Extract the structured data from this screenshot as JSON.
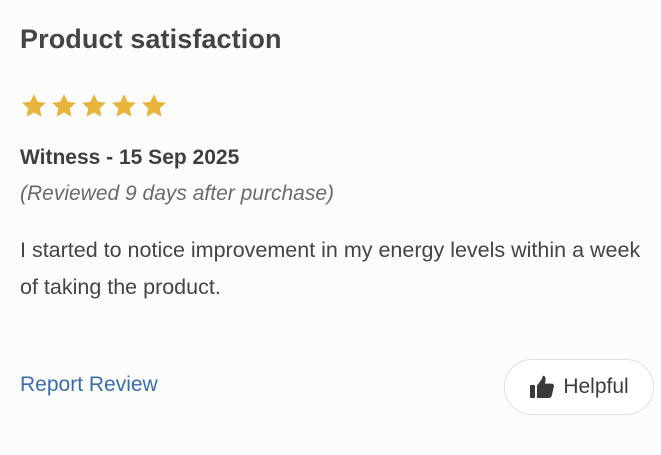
{
  "review": {
    "title": "Product satisfaction",
    "rating": 5,
    "rating_max": 5,
    "star_color": "#e8b53c",
    "star_icon": "star-icon",
    "author_line": "Witness - 15 Sep 2025",
    "reviewed_note": "(Reviewed 9 days after purchase)",
    "body": "I started to notice improvement in my energy levels within a week of taking the product."
  },
  "actions": {
    "report_label": "Report Review",
    "report_color": "#3a6ea8",
    "helpful_label": "Helpful",
    "helpful_icon": "thumbs-up-icon"
  }
}
